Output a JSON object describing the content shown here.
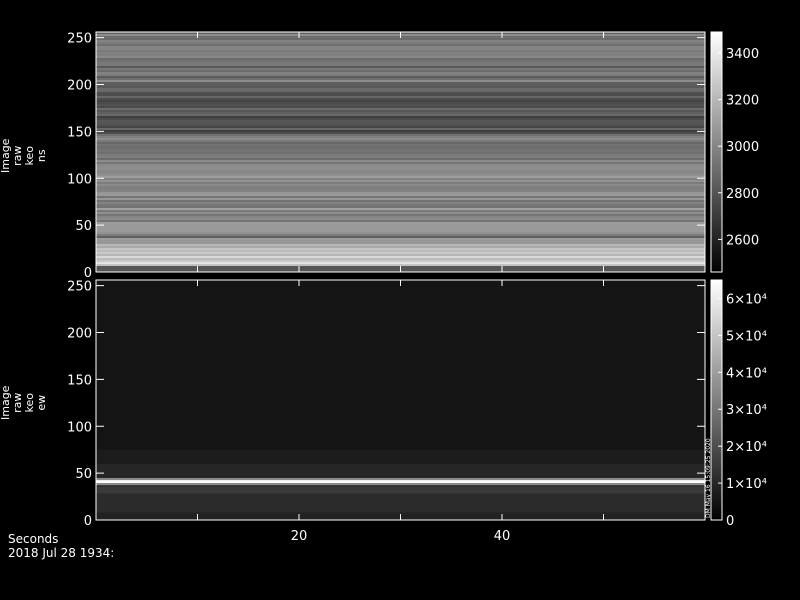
{
  "chart_data": [
    {
      "type": "heatmap",
      "ylabel_lines": [
        "Image",
        "raw",
        "keo",
        "ns"
      ],
      "ylim": [
        0,
        256
      ],
      "yticks": [
        0,
        50,
        100,
        150,
        200,
        250
      ],
      "xlim": [
        0,
        60
      ],
      "colorbar": {
        "range": [
          2460,
          3490
        ],
        "ticks": [
          2600,
          2800,
          3000,
          3200,
          3400
        ],
        "tick_labels": [
          "2600",
          "2800",
          "3000",
          "3200",
          "3400"
        ]
      },
      "colormap": "grayscale"
    },
    {
      "type": "heatmap",
      "ylabel_lines": [
        "Image",
        "raw",
        "keo",
        "ew"
      ],
      "ylim": [
        0,
        256
      ],
      "yticks": [
        0,
        50,
        100,
        150,
        200,
        250
      ],
      "xlim": [
        0,
        60
      ],
      "xticks": [
        20,
        40
      ],
      "colorbar": {
        "range": [
          0,
          65000
        ],
        "ticks": [
          0,
          10000,
          20000,
          30000,
          40000,
          50000,
          60000
        ],
        "tick_labels": [
          "0",
          "1×10⁴",
          "2×10⁴",
          "3×10⁴",
          "4×10⁴",
          "5×10⁴",
          "6×10⁴"
        ]
      },
      "colorbar_note": "DM May 16 15:09:25 2020",
      "colormap": "grayscale",
      "bright_band": {
        "center": 41,
        "width": 8
      }
    }
  ],
  "footer": {
    "xlabel": "Seconds",
    "date": "2018 Jul 28 1934:"
  }
}
